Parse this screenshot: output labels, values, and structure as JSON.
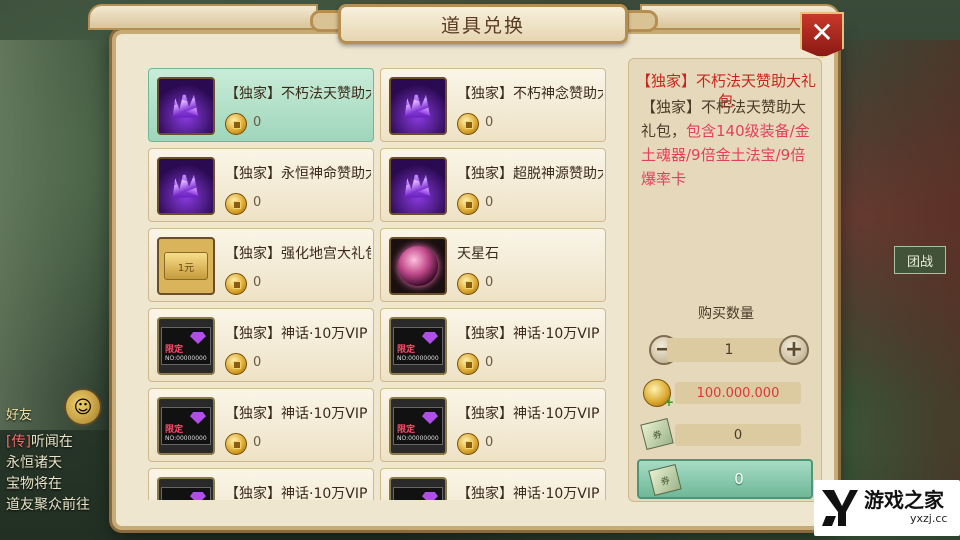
{
  "dialog": {
    "title": "道具兑换",
    "close_label": "✕"
  },
  "items": [
    {
      "name": "【独家】不朽法天赞助大礼包",
      "price": "0",
      "icon": "crystal",
      "selected": true
    },
    {
      "name": "【独家】不朽神念赞助大礼包",
      "price": "0",
      "icon": "crystal",
      "selected": false
    },
    {
      "name": "【独家】永恒神命赞助大礼包",
      "price": "0",
      "icon": "crystal",
      "selected": false
    },
    {
      "name": "【独家】超脱神源赞助大礼包",
      "price": "0",
      "icon": "crystal",
      "selected": false
    },
    {
      "name": "【独家】强化地宫大礼包",
      "price": "0",
      "icon": "gold",
      "selected": false
    },
    {
      "name": "天星石",
      "price": "0",
      "icon": "orb",
      "selected": false
    },
    {
      "name": "【独家】神话·10万VIP",
      "price": "0",
      "icon": "ticket",
      "selected": false
    },
    {
      "name": "【独家】神话·10万VIP",
      "price": "0",
      "icon": "ticket",
      "selected": false
    },
    {
      "name": "【独家】神话·10万VIP",
      "price": "0",
      "icon": "ticket",
      "selected": false
    },
    {
      "name": "【独家】神话·10万VIP",
      "price": "0",
      "icon": "ticket",
      "selected": false
    },
    {
      "name": "【独家】神话·10万VIP",
      "price": "0",
      "icon": "ticket",
      "selected": false
    },
    {
      "name": "【独家】神话·10万VIP",
      "price": "0",
      "icon": "ticket",
      "selected": false
    }
  ],
  "ticket_card": {
    "limited": "限定",
    "number": "NO:00000000"
  },
  "gold_card": {
    "text": "1元"
  },
  "detail": {
    "title": "【独家】不朽法天赞助大礼包",
    "desc_plain": "【独家】不朽法天赞助大礼包，",
    "desc_highlight": "包含140级装备/金土魂器/9倍金土法宝/9倍爆率卡",
    "qty_label": "购买数量",
    "qty_value": "1",
    "minus_label": "−",
    "plus_label": "+",
    "cost_value": "100.000.000",
    "ticket_value": "0",
    "buy_value": "0",
    "ticket_icon_text": "券"
  },
  "background": {
    "friend_label": "好友",
    "chat_lines": [
      {
        "tag": "[传]",
        "text": "听闻在"
      },
      {
        "tag": "",
        "text": "永恒诸天"
      },
      {
        "tag": "",
        "text": "宝物将在"
      },
      {
        "tag": "",
        "text": "道友聚众前往"
      }
    ],
    "right_badge": "团战"
  },
  "logo": {
    "text": "游戏之家",
    "url": "yxzj.cc"
  },
  "colors": {
    "accent_red": "#c8261c",
    "highlight_pink": "#e2405e",
    "selected_green": "#9fd6bb",
    "panel_cream": "#efe6cf",
    "frame_gold": "#c7ab76"
  }
}
